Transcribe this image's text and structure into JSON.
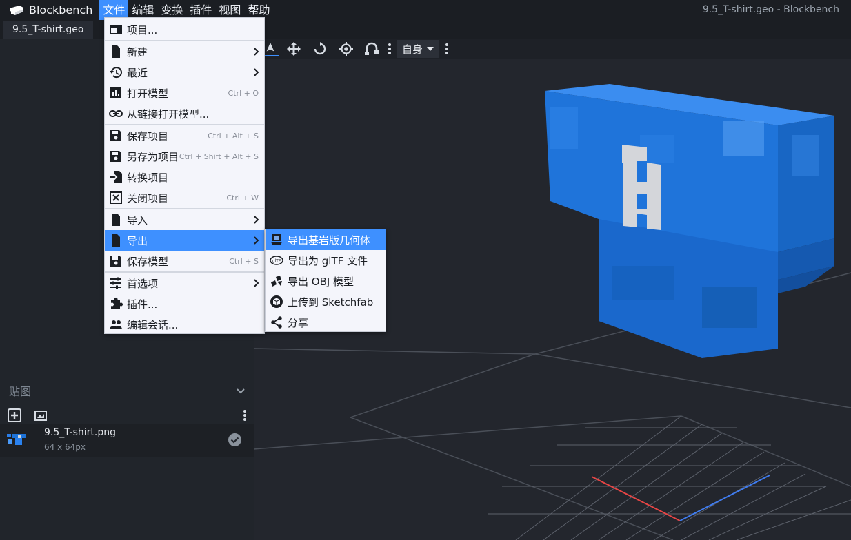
{
  "app": {
    "name": "Blockbench",
    "window_title": "9.5_T-shirt.geo - Blockbench"
  },
  "menubar": {
    "file": "文件",
    "edit": "编辑",
    "transform": "变换",
    "plugins": "插件",
    "view": "视图",
    "help": "帮助"
  },
  "tab": {
    "label": "9.5_T-shirt.geo"
  },
  "file_menu": {
    "project": "项目...",
    "new": "新建",
    "recent": "最近",
    "open_model": "打开模型",
    "open_model_key": "Ctrl + O",
    "open_from_link": "从链接打开模型...",
    "save_project": "保存项目",
    "save_project_key": "Ctrl + Alt + S",
    "save_project_as": "另存为项目",
    "save_project_as_key": "Ctrl + Shift + Alt + S",
    "convert_project": "转换项目",
    "close_project": "关闭项目",
    "close_project_key": "Ctrl + W",
    "import": "导入",
    "export": "导出",
    "save_model": "保存模型",
    "save_model_key": "Ctrl + S",
    "preferences": "首选项",
    "plugins": "插件...",
    "edit_session": "编辑会话..."
  },
  "export_menu": {
    "bedrock_geometry": "导出基岩版几何体",
    "gltf": "导出为 glTF 文件",
    "obj": "导出 OBJ 模型",
    "sketchfab": "上传到 Sketchfab",
    "share": "分享"
  },
  "viewport": {
    "transform_space": "自身"
  },
  "textures_panel": {
    "title": "贴图",
    "texture": {
      "name": "9.5_T-shirt.png",
      "size": "64 x 64px"
    }
  },
  "colors": {
    "accent": "#3e90ff",
    "menubar_bg": "#1b1e23",
    "sidebar_bg": "#21252b",
    "viewport_bg": "#23262d",
    "menu_bg": "#f4f5fb",
    "shirt_blue": "#1e73d8",
    "shirt_logo": "#d4d6da"
  }
}
